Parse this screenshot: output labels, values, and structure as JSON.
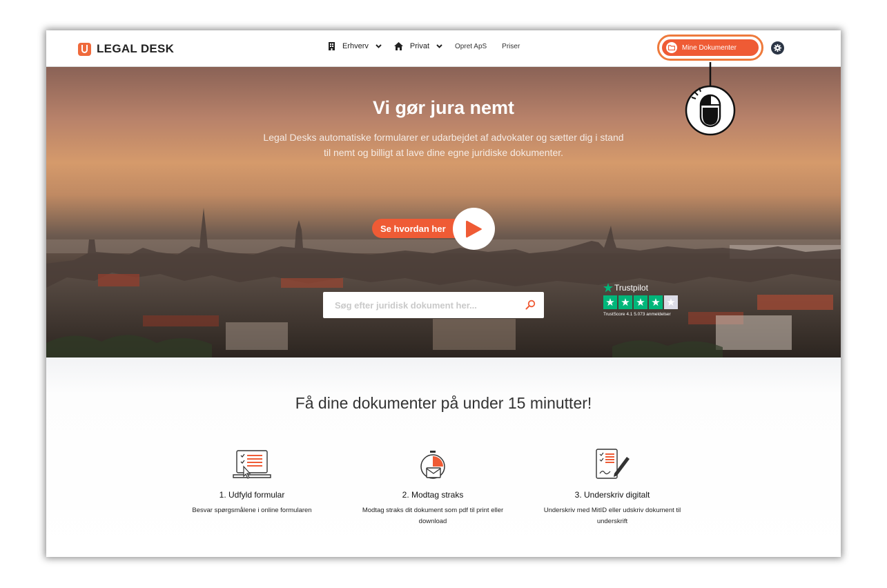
{
  "header": {
    "brand": "LEGAL DESK",
    "nav": {
      "erhverv": "Erhverv",
      "privat": "Privat",
      "opret_aps": "Opret ApS",
      "priser": "Priser"
    },
    "mine_dokumenter": "Mine Dokumenter"
  },
  "hero": {
    "title": "Vi gør jura nemt",
    "subtitle": "Legal Desks automatiske formularer er udarbejdet af advokater og sætter dig i stand til nemt og billigt at lave dine egne juridiske dokumenter.",
    "video_label": "Se hvordan her",
    "search_placeholder": "Søg efter juridisk dokument her...",
    "trustpilot": {
      "brand": "Trustpilot",
      "rating_stars": 4,
      "score_text": "TrustScore 4.1 5.073 anmeldelser"
    }
  },
  "steps_section": {
    "tagline": "Få dine dokumenter på under 15 minutter!",
    "steps": [
      {
        "title": "1. Udfyld formular",
        "desc": "Besvar spørgsmålene i online formularen"
      },
      {
        "title": "2. Modtag straks",
        "desc": "Modtag straks dit dokument som pdf til print eller download"
      },
      {
        "title": "3. Underskriv digitalt",
        "desc": "Underskriv med MitID eller udskriv dokument til underskrift"
      }
    ]
  },
  "colors": {
    "accent": "#ef5b35",
    "highlight_ring": "#ee7a3c",
    "trustpilot_green": "#00b67a",
    "text_dark": "#222222"
  },
  "icons": [
    "building-icon",
    "home-icon",
    "chevron-down-icon",
    "folder-icon",
    "gear-icon",
    "play-icon",
    "search-icon",
    "trustpilot-star-icon",
    "form-checklist-icon",
    "stopwatch-mail-icon",
    "sign-document-icon",
    "mouse-click-icon"
  ]
}
